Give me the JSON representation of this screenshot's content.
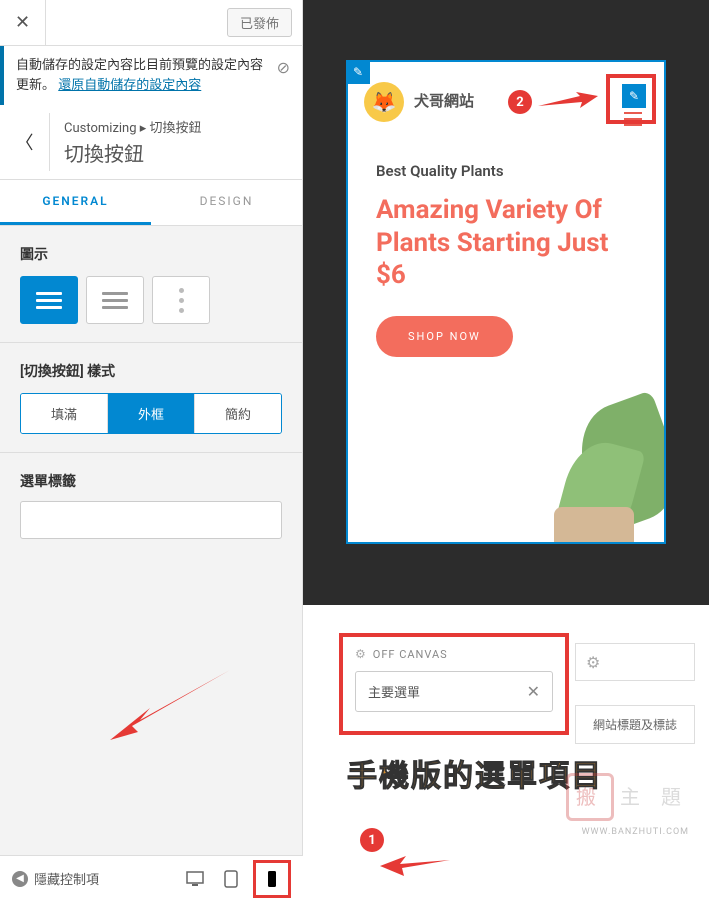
{
  "topbar": {
    "publish_label": "已發佈"
  },
  "notice": {
    "text": "自動儲存的設定內容比目前預覽的設定內容更新。",
    "link_text": "還原自動儲存的設定內容"
  },
  "breadcrumb": {
    "path": "Customizing ▸ 切換按鈕",
    "title": "切換按鈕"
  },
  "tabs": {
    "general": "GENERAL",
    "design": "DESIGN"
  },
  "sections": {
    "icon_label": "圖示",
    "style_label": "[切換按鈕] 樣式",
    "styles": {
      "fill": "填滿",
      "outline": "外框",
      "minimal": "簡約"
    },
    "menu_label_title": "選單標籤"
  },
  "bottombar": {
    "collapse": "隱藏控制項"
  },
  "preview": {
    "site_name": "犬哥網站",
    "small_heading": "Best Quality Plants",
    "big_heading": "Amazing Variety Of Plants Starting Just $6",
    "shop_btn": "SHOP NOW"
  },
  "panel": {
    "off_canvas": "OFF CANVAS",
    "menu_item": "主要選單",
    "title_logo": "網站標題及標誌"
  },
  "annotation": {
    "text": "手機版的選單項目",
    "watermark": "主 題",
    "watermark_stamp": "搬",
    "watermark_url": "WWW.BANZHUTI.COM"
  },
  "callouts": {
    "one": "1",
    "two": "2"
  }
}
